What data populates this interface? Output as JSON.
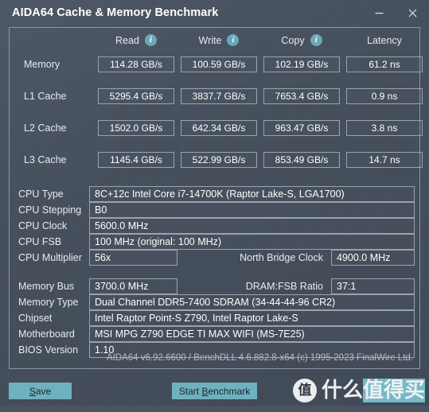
{
  "window": {
    "title": "AIDA64 Cache & Memory Benchmark",
    "minimize_label": "Minimize",
    "close_label": "Close"
  },
  "benchmark": {
    "columns": [
      {
        "label": "Read",
        "has_info": true,
        "icon": "info-icon"
      },
      {
        "label": "Write",
        "has_info": true,
        "icon": "info-icon"
      },
      {
        "label": "Copy",
        "has_info": true,
        "icon": "info-icon"
      },
      {
        "label": "Latency",
        "has_info": false,
        "icon": ""
      }
    ],
    "rows": [
      {
        "name": "Memory",
        "read": "114.28 GB/s",
        "write": "100.59 GB/s",
        "copy": "102.19 GB/s",
        "latency": "61.2 ns"
      },
      {
        "name": "L1 Cache",
        "read": "5295.4 GB/s",
        "write": "3837.7 GB/s",
        "copy": "7653.4 GB/s",
        "latency": "0.9 ns"
      },
      {
        "name": "L2 Cache",
        "read": "1502.0 GB/s",
        "write": "642.34 GB/s",
        "copy": "963.47 GB/s",
        "latency": "3.8 ns"
      },
      {
        "name": "L3 Cache",
        "read": "1145.4 GB/s",
        "write": "522.99 GB/s",
        "copy": "853.49 GB/s",
        "latency": "14.7 ns"
      }
    ]
  },
  "cpu_info": {
    "cpu_type_label": "CPU Type",
    "cpu_type_value": "8C+12c Intel Core i7-14700K  (Raptor Lake-S, LGA1700)",
    "cpu_stepping_label": "CPU Stepping",
    "cpu_stepping_value": "B0",
    "cpu_clock_label": "CPU Clock",
    "cpu_clock_value": "5600.0 MHz",
    "cpu_fsb_label": "CPU FSB",
    "cpu_fsb_value": "100 MHz  (original: 100 MHz)",
    "cpu_multiplier_label": "CPU Multiplier",
    "cpu_multiplier_value": "56x",
    "north_bridge_label": "North Bridge Clock",
    "north_bridge_value": "4900.0 MHz"
  },
  "memory_info": {
    "memory_bus_label": "Memory Bus",
    "memory_bus_value": "3700.0 MHz",
    "dram_fsb_label": "DRAM:FSB Ratio",
    "dram_fsb_value": "37:1",
    "memory_type_label": "Memory Type",
    "memory_type_value": "Dual Channel DDR5-7400 SDRAM  (34-44-44-96 CR2)",
    "chipset_label": "Chipset",
    "chipset_value": "Intel Raptor Point-S Z790, Intel Raptor Lake-S",
    "motherboard_label": "Motherboard",
    "motherboard_value": "MSI MPG Z790 EDGE TI MAX WIFI (MS-7E25)",
    "bios_label": "BIOS Version",
    "bios_value": "1.10"
  },
  "footer": {
    "version_note": "AIDA64 v6.92.6600 / BenchDLL 4.6.882.8-x64  (c) 1995-2023 FinalWire Ltd."
  },
  "actions": {
    "save_label": "Save",
    "save_accel": "S",
    "start_label": "Start Benchmark",
    "start_accel": "B"
  },
  "watermark": {
    "mark": "值",
    "text_plain": "什么",
    "text_highlight": "值得买"
  },
  "colors": {
    "accent": "#6fb1be",
    "info_icon": "#6aa9b8",
    "window_bg": "#474f5d",
    "border": "#9aa3b0",
    "text": "#ffffff",
    "muted_text": "#b6bdc8",
    "statusbar": "#495362",
    "watermark_highlight": "#79c4d2"
  }
}
